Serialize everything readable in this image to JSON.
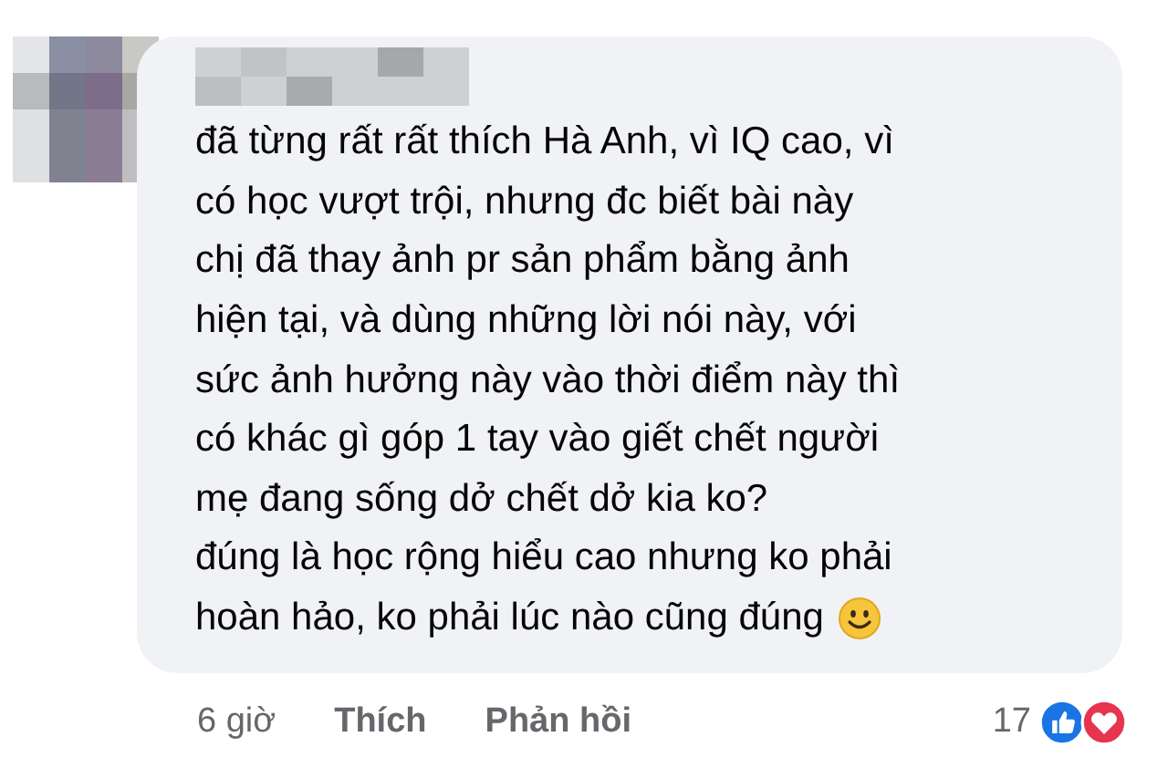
{
  "comment": {
    "lines": [
      "đã từng rất rất thích Hà Anh, vì IQ cao, vì",
      "có học vượt trội, nhưng đc biết bài này",
      "chị đã thay ảnh pr sản phẩm bằng ảnh",
      "hiện tại, và dùng những lời nói này, với",
      "sức ảnh hưởng này vào thời điểm này thì",
      "có khác gì góp 1 tay vào giết chết người",
      "mẹ đang sống dở chết dở kia ko?",
      "đúng là học rộng hiểu cao nhưng ko phải",
      "hoàn hảo, ko phải lúc nào cũng đúng"
    ],
    "ends_with_smiley": true
  },
  "footer": {
    "time": "6 giờ",
    "actions": [
      "Thích",
      "Phản hồi"
    ],
    "reaction_count": "17"
  }
}
